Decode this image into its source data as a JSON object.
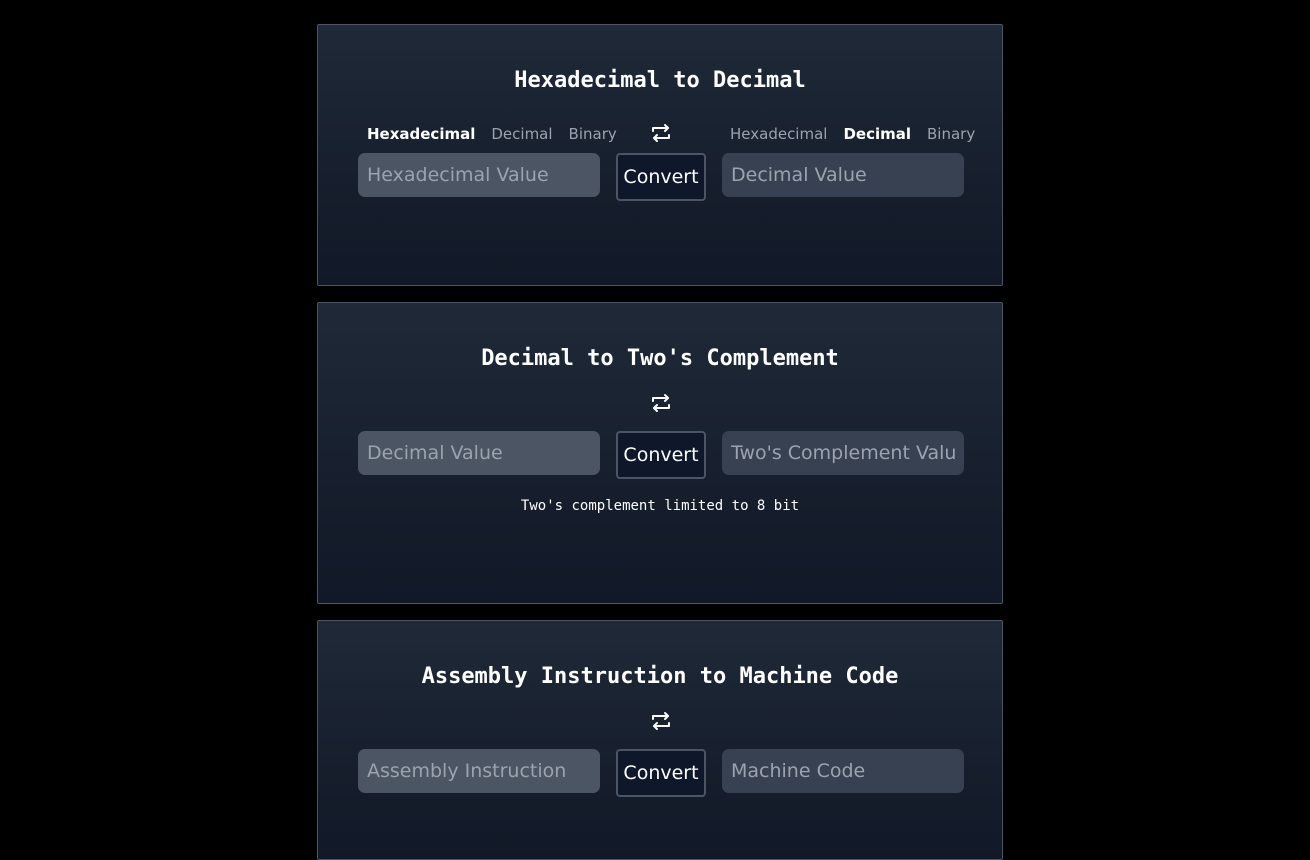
{
  "converters": [
    {
      "title": "Hexadecimal to Decimal",
      "from_tabs": [
        "Hexadecimal",
        "Decimal",
        "Binary"
      ],
      "from_active": "Hexadecimal",
      "to_tabs": [
        "Hexadecimal",
        "Decimal",
        "Binary"
      ],
      "to_active": "Decimal",
      "input_placeholder": "Hexadecimal Value",
      "output_placeholder": "Decimal Value",
      "convert_label": "Convert",
      "swap_icon": "swap-arrows-icon"
    },
    {
      "title": "Decimal to Two's Complement",
      "input_placeholder": "Decimal Value",
      "output_placeholder": "Two's Complement Value",
      "convert_label": "Convert",
      "note": "Two's complement limited to 8 bit",
      "swap_icon": "swap-arrows-icon"
    },
    {
      "title": "Assembly Instruction to Machine Code",
      "input_placeholder": "Assembly Instruction",
      "output_placeholder": "Machine Code",
      "convert_label": "Convert",
      "swap_icon": "swap-arrows-icon"
    }
  ],
  "colors": {
    "page_background": "#000000",
    "card_gradient_top": "#1f2937",
    "card_gradient_bottom": "#111827",
    "input_left": "#4b5563",
    "input_right": "#374151",
    "button_background": "#0f172a"
  }
}
